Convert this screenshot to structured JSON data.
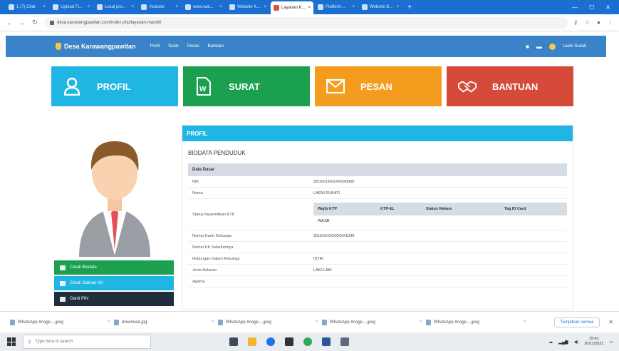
{
  "browser": {
    "tabs": [
      {
        "label": "1 (7) Chat"
      },
      {
        "label": "Upload Fi..."
      },
      {
        "label": "Local pro..."
      },
      {
        "label": "Youtube"
      },
      {
        "label": "www.wal..."
      },
      {
        "label": "Website K..."
      },
      {
        "label": "Layanan K..."
      },
      {
        "label": "Platform..."
      },
      {
        "label": "Website D..."
      }
    ],
    "active_tab_index": 6,
    "url": "desa.karawangpawitan.com/index.php/layanan-mandiri"
  },
  "app": {
    "brand": "Desa Karawangpawitan",
    "nav": [
      "Profil",
      "Surat",
      "Pesan",
      "Bantuan"
    ],
    "user_label": "Laeni Sukati"
  },
  "tiles": [
    {
      "label": "PROFIL",
      "color": "#1fb6e4"
    },
    {
      "label": "SURAT",
      "color": "#1aa04f"
    },
    {
      "label": "PESAN",
      "color": "#f39c1d"
    },
    {
      "label": "BANTUAN",
      "color": "#d64a39"
    }
  ],
  "sidebar_buttons": {
    "biodata": "Cetak Biodata",
    "sidik": "Cetak Salinan KK",
    "pin": "Ganti PIN"
  },
  "panel": {
    "title": "PROFIL",
    "biodata_title": "BIODATA PENDUDUK",
    "section_label": "Data Dasar",
    "rows": [
      {
        "label": "NIK",
        "value": "3215XXXXXXXXX0005"
      },
      {
        "label": "Nama",
        "value": "LAENI SUKATI"
      },
      {
        "label": "Status Kepemilikan KTP",
        "value": ""
      },
      {
        "label": "Nomor Kartu Keluarga",
        "value": "3215XXXXXXXXX1230"
      },
      {
        "label": "Nomor KK Sebelumnya",
        "value": ""
      },
      {
        "label": "Hubungan Dalam Keluarga",
        "value": "ISTRI"
      },
      {
        "label": "Jenis Kelamin",
        "value": "LAKI-LAKI"
      },
      {
        "label": "Agama",
        "value": ""
      }
    ],
    "ktp_table": {
      "headers": [
        "Wajib KTP",
        "KTP-EL",
        "Status Rekam",
        "Tag ID Card"
      ],
      "values": [
        "WAJIB",
        "",
        "",
        ""
      ]
    }
  },
  "downloads": [
    "WhatsApp Image....jpeg",
    "download.jpg",
    "WhatsApp Image....jpeg",
    "WhatsApp Image....jpeg",
    "WhatsApp Image....jpeg"
  ],
  "downloads_show_all": "Tampilkan semua",
  "taskbar": {
    "search_placeholder": "Type here to search",
    "time": "15:41",
    "date": "20/11/2021"
  }
}
